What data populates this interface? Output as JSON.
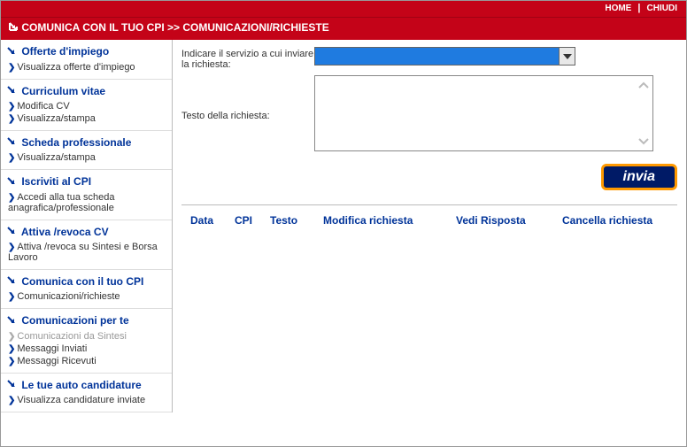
{
  "topbar": {
    "home": "HOME",
    "close": "CHIUDI"
  },
  "titlebar": {
    "text": "COMUNICA CON IL TUO CPI >> COMUNICAZIONI/RICHIESTE"
  },
  "sidebar": {
    "sections": [
      {
        "header": "Offerte d'impiego",
        "items": [
          {
            "label": "Visualizza offerte d'impiego"
          }
        ]
      },
      {
        "header": "Curriculum vitae",
        "items": [
          {
            "label": "Modifica CV"
          },
          {
            "label": "Visualizza/stampa"
          }
        ]
      },
      {
        "header": "Scheda professionale",
        "items": [
          {
            "label": "Visualizza/stampa"
          }
        ]
      },
      {
        "header": "Iscriviti al CPI",
        "items": [
          {
            "label": "Accedi alla tua scheda anagrafica/professionale"
          }
        ]
      },
      {
        "header": "Attiva /revoca CV",
        "items": [
          {
            "label": "Attiva /revoca su Sintesi e Borsa Lavoro"
          }
        ]
      },
      {
        "header": "Comunica con il tuo CPI",
        "items": [
          {
            "label": "Comunicazioni/richieste"
          }
        ]
      },
      {
        "header": "Comunicazioni per te",
        "items": [
          {
            "label": "Comunicazioni da Sintesi",
            "disabled": true
          },
          {
            "label": "Messaggi Inviati"
          },
          {
            "label": "Messaggi Ricevuti"
          }
        ]
      },
      {
        "header": "Le tue auto candidature",
        "items": [
          {
            "label": "Visualizza candidature inviate"
          }
        ]
      }
    ]
  },
  "form": {
    "service_label": "Indicare il servizio a cui inviare la richiesta:",
    "text_label": "Testo della richiesta:",
    "submit": "invia"
  },
  "table": {
    "headers": {
      "data": "Data",
      "cpi": "CPI",
      "testo": "Testo",
      "modifica": "Modifica richiesta",
      "vedi": "Vedi Risposta",
      "cancella": "Cancella richiesta"
    }
  }
}
